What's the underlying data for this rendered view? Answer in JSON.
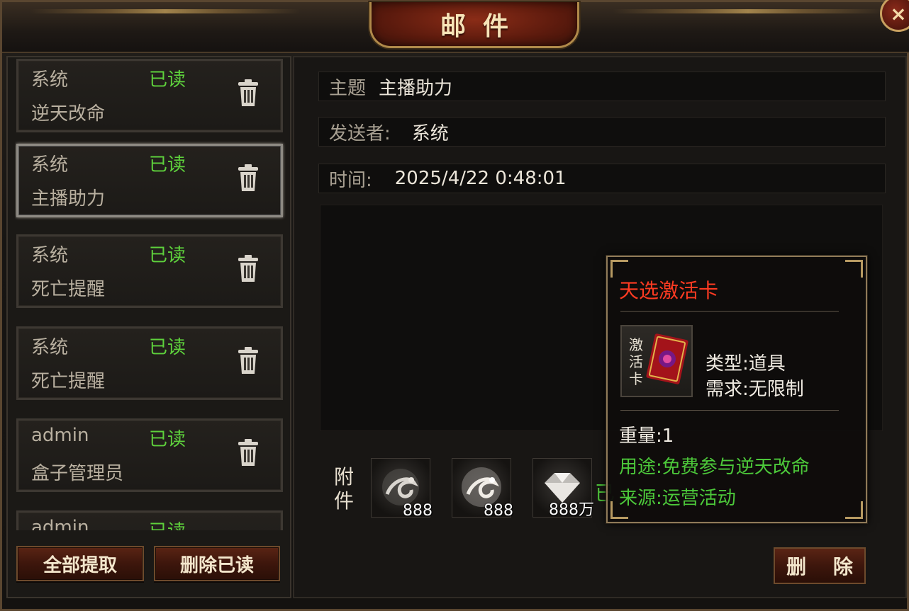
{
  "window": {
    "title": "邮件",
    "close_icon": "close-icon"
  },
  "mails": [
    {
      "sender": "系统",
      "status": "已读",
      "subject": "逆天改命"
    },
    {
      "sender": "系统",
      "status": "已读",
      "subject": "主播助力",
      "selected": true
    },
    {
      "sender": "系统",
      "status": "已读",
      "subject": "死亡提醒"
    },
    {
      "sender": "系统",
      "status": "已读",
      "subject": "死亡提醒"
    },
    {
      "sender": "admin",
      "status": "已读",
      "subject": "盒子管理员"
    },
    {
      "sender": "admin",
      "status": "已读",
      "subject": ""
    }
  ],
  "list_buttons": {
    "claim_all": "全部提取",
    "delete_read": "删除已读"
  },
  "detail": {
    "subject_label": "主题",
    "subject": "主播助力",
    "sender_label": "发送者:",
    "sender": "系统",
    "time_label": "时间:",
    "time": "2025/4/22 0:48:01"
  },
  "attachments": {
    "label": "附件",
    "items": [
      {
        "icon": "dragon-emblem-icon",
        "count": "888"
      },
      {
        "icon": "dragon-emblem-icon",
        "count": "888"
      },
      {
        "icon": "diamond-icon",
        "count": "888万"
      }
    ],
    "partial_text": "已"
  },
  "delete_button": "删 除",
  "tooltip": {
    "name": "天选激活卡",
    "icon_text": "激活卡",
    "type": "类型:道具",
    "requirement": "需求:无限制",
    "weight": "重量:1",
    "usage": "用途:免费参与逆天改命",
    "source": "来源:运营活动"
  },
  "colors": {
    "read_status": "#5ed13c",
    "item_name": "#ff3b22",
    "tooltip_green": "#4cc83a"
  }
}
